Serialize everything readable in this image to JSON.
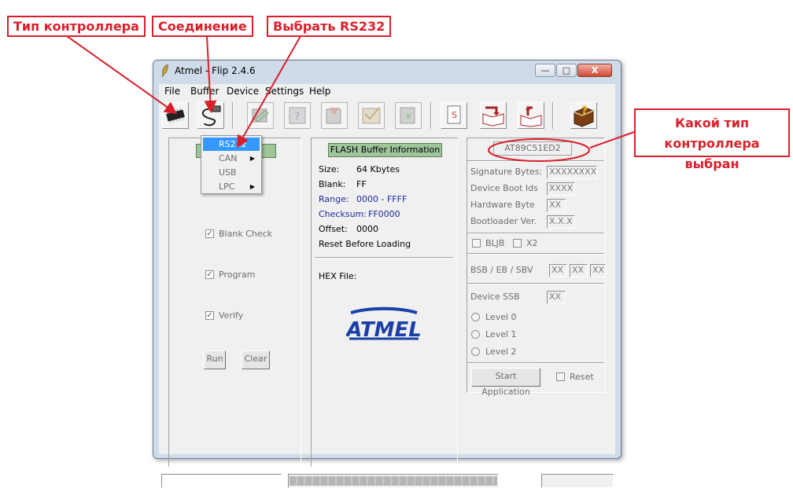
{
  "annotations": {
    "controller_type": "Тип контроллера",
    "connection": "Соединение",
    "select_rs232": "Выбрать RS232",
    "which_controller": "Какой тип контроллера выбран"
  },
  "window": {
    "title": "Atmel - Flip 2.4.6",
    "controls": {
      "minimize": "—",
      "maximize": "□",
      "close": "X"
    }
  },
  "menu": [
    "File",
    "Buffer",
    "Device",
    "Settings",
    "Help"
  ],
  "toolbar": {
    "icons": [
      "chip-icon",
      "cable-icon",
      "erase-icon",
      "blank-check-icon",
      "program-icon",
      "verify-icon",
      "read-icon",
      "load-hex-icon",
      "save-buffer-icon",
      "edit-buffer-icon",
      "help-book-icon"
    ]
  },
  "connection_menu": {
    "items": [
      {
        "label": "RS232",
        "submenu": false,
        "selected": true
      },
      {
        "label": "CAN",
        "submenu": true,
        "selected": false
      },
      {
        "label": "USB",
        "submenu": false,
        "selected": false
      },
      {
        "label": "LPC",
        "submenu": true,
        "selected": false
      }
    ]
  },
  "operations": {
    "checks": [
      {
        "label": "Blank Check",
        "checked": true
      },
      {
        "label": "Program",
        "checked": true
      },
      {
        "label": "Verify",
        "checked": true
      }
    ],
    "run": "Run",
    "clear": "Clear"
  },
  "buffer": {
    "header": "FLASH Buffer Information",
    "rows": [
      {
        "label": "Size:",
        "value": "64 Kbytes",
        "blue": false
      },
      {
        "label": "Blank:",
        "value": "FF",
        "blue": false
      },
      {
        "label": "Range:",
        "value": "0000 - FFFF",
        "blue": true
      },
      {
        "label": "Checksum:",
        "value": "FF0000",
        "blue": true
      },
      {
        "label": "Offset:",
        "value": "0000",
        "blue": false
      }
    ],
    "reset_before_loading": "Reset Before Loading",
    "hex_file": "HEX File:",
    "logo": "ATMEL"
  },
  "device": {
    "name": "AT89C51ED2",
    "fields": [
      {
        "label": "Signature Bytes:",
        "value": "XXXXXXXX"
      },
      {
        "label": "Device Boot Ids",
        "value": "XXXX"
      },
      {
        "label": "Hardware Byte",
        "value": "XX"
      },
      {
        "label": "Bootloader Ver.",
        "value": "X.X.X"
      }
    ],
    "bljb": "BLJB",
    "x2": "X2",
    "bsb_label": "BSB / EB / SBV",
    "bsb_values": [
      "XX",
      "XX",
      "XX"
    ],
    "ssb_label": "Device SSB",
    "ssb_value": "XX",
    "levels": [
      "Level 0",
      "Level 1",
      "Level 2"
    ],
    "start_application": "Start Application",
    "reset": "Reset"
  },
  "colors": {
    "annotation": "#d9202a",
    "window_frame": "#cfdbe9",
    "face": "#f0f0f0",
    "green_header": "#9fc59a",
    "atmel_blue": "#1a3fa8",
    "menu_selection": "#3399ff"
  }
}
